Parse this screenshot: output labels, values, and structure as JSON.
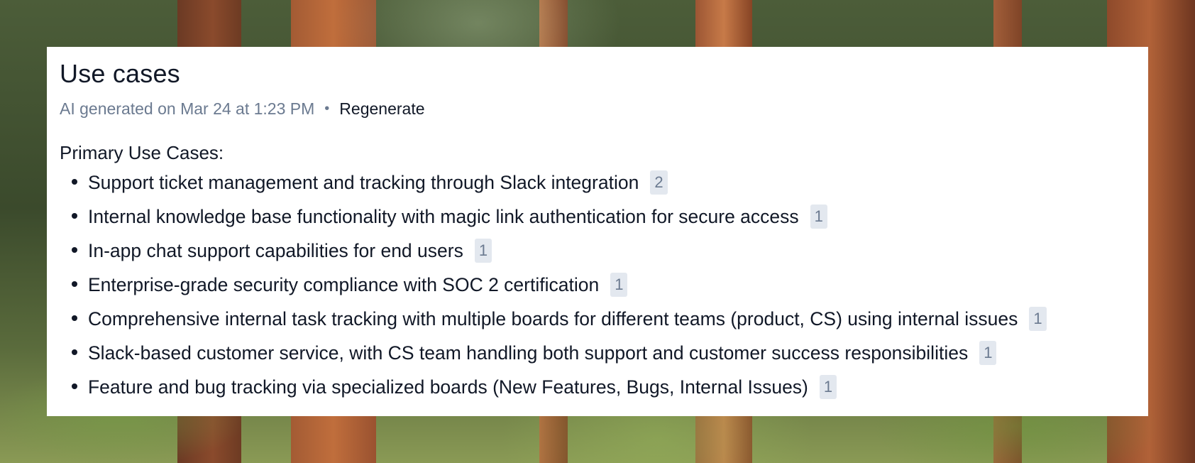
{
  "card": {
    "title": "Use cases",
    "generated_text": "AI generated on Mar 24 at 1:23 PM",
    "separator": "•",
    "regenerate_label": "Regenerate",
    "section_label": "Primary Use Cases:",
    "items": [
      {
        "text": "Support ticket management and tracking through Slack integration",
        "count": "2"
      },
      {
        "text": "Internal knowledge base functionality with magic link authentication for secure access",
        "count": "1"
      },
      {
        "text": "In-app chat support capabilities for end users",
        "count": "1"
      },
      {
        "text": "Enterprise-grade security compliance with SOC 2 certification",
        "count": "1"
      },
      {
        "text": "Comprehensive internal task tracking with multiple boards for different teams (product, CS) using internal issues",
        "count": "1"
      },
      {
        "text": "Slack-based customer service, with CS team handling both support and customer success responsibilities",
        "count": "1"
      },
      {
        "text": "Feature and bug tracking via specialized boards (New Features, Bugs, Internal Issues)",
        "count": "1"
      }
    ]
  },
  "colors": {
    "title": "#111827",
    "muted": "#6b7a90",
    "badge_bg": "#e3e8ef",
    "card_bg": "#ffffff"
  }
}
